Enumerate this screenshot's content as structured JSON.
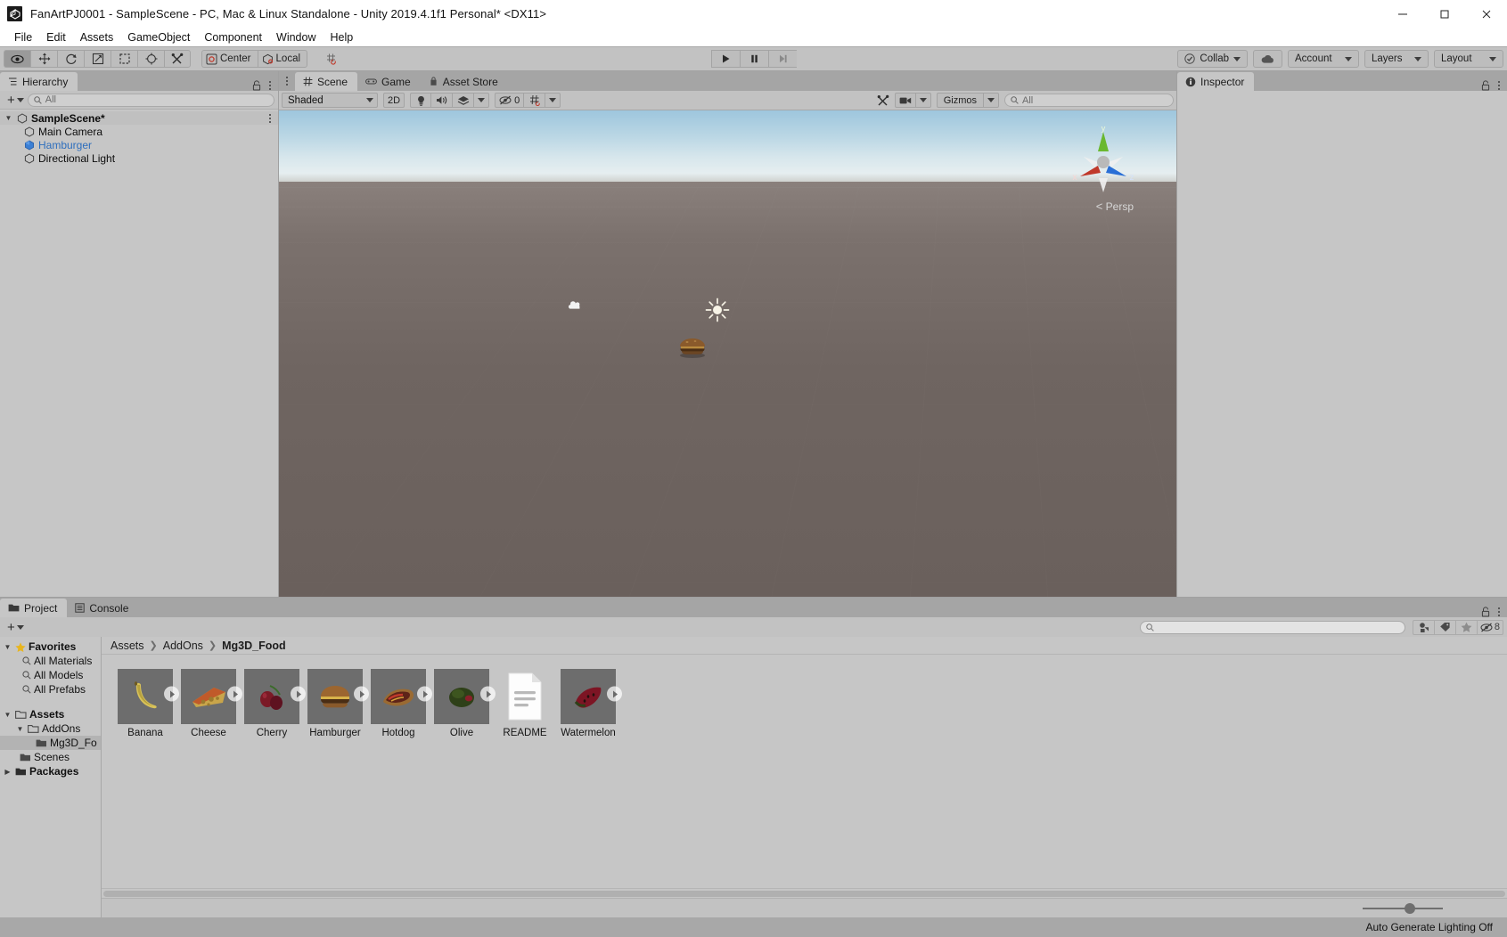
{
  "window": {
    "title": "FanArtPJ0001 - SampleScene - PC, Mac & Linux Standalone - Unity 2019.4.1f1 Personal* <DX11>",
    "minimize": "—",
    "maximize": "□",
    "close": "✕"
  },
  "menu": {
    "items": [
      "File",
      "Edit",
      "Assets",
      "GameObject",
      "Component",
      "Window",
      "Help"
    ]
  },
  "toolbar": {
    "tools": [
      {
        "name": "hand-tool-icon",
        "label": ""
      },
      {
        "name": "move-tool-icon",
        "label": ""
      },
      {
        "name": "rotate-tool-icon",
        "label": ""
      },
      {
        "name": "scale-tool-icon",
        "label": ""
      },
      {
        "name": "rect-tool-icon",
        "label": ""
      },
      {
        "name": "transform-tool-icon",
        "label": ""
      },
      {
        "name": "custom-tool-icon",
        "label": ""
      }
    ],
    "pivot": "Center",
    "space": "Local",
    "play": "▶",
    "pause": "❙❙",
    "step": "▶❙",
    "collab": "Collab",
    "cloud": "cloud-icon",
    "account": "Account",
    "layers": "Layers",
    "layout": "Layout"
  },
  "hierarchy": {
    "tab": "Hierarchy",
    "search_placeholder": "All",
    "create_label": "+",
    "tree": [
      {
        "label": "SampleScene*",
        "depth": 0,
        "expanded": true,
        "type": "scene",
        "selected": false
      },
      {
        "label": "Main Camera",
        "depth": 1,
        "expanded": false,
        "type": "object",
        "selected": false
      },
      {
        "label": "Hamburger",
        "depth": 1,
        "expanded": false,
        "type": "prefab",
        "selected": true
      },
      {
        "label": "Directional Light",
        "depth": 1,
        "expanded": false,
        "type": "object",
        "selected": false
      }
    ]
  },
  "scene": {
    "tabs": [
      {
        "label": "Scene",
        "icon": "grid-icon",
        "selected": true
      },
      {
        "label": "Game",
        "icon": "gamepad-icon",
        "selected": false
      },
      {
        "label": "Asset Store",
        "icon": "store-icon",
        "selected": false
      }
    ],
    "draw_mode": "Shaded",
    "mode_2d": "2D",
    "lighting_icon": "light-bulb-icon",
    "audio_icon": "audio-icon",
    "fx_icon": "fx-icon",
    "hidden_count": "0",
    "grid_icon": "grid-visibility-icon",
    "tools_icon": "scene-tools-icon",
    "camera_icon": "scene-camera-icon",
    "gizmos": "Gizmos",
    "search_placeholder": "All",
    "view_label": "Persp",
    "axis": {
      "x": "x",
      "y": "y",
      "z": "z"
    }
  },
  "inspector": {
    "tab": "Inspector"
  },
  "project": {
    "tabs": [
      {
        "label": "Project",
        "icon": "folder-icon",
        "selected": true
      },
      {
        "label": "Console",
        "icon": "console-icon",
        "selected": false
      }
    ],
    "create_label": "+",
    "search_placeholder": "",
    "filter_count": "8",
    "breadcrumb": [
      "Assets",
      "AddOns",
      "Mg3D_Food"
    ],
    "tree": [
      {
        "label": "Favorites",
        "depth": 0,
        "bold": true,
        "expanded": true,
        "icon": "star-icon",
        "selected": false
      },
      {
        "label": "All Materials",
        "depth": 1,
        "bold": false,
        "expanded": null,
        "icon": "search-icon",
        "selected": false
      },
      {
        "label": "All Models",
        "depth": 1,
        "bold": false,
        "expanded": null,
        "icon": "search-icon",
        "selected": false
      },
      {
        "label": "All Prefabs",
        "depth": 1,
        "bold": false,
        "expanded": null,
        "icon": "search-icon",
        "selected": false
      },
      {
        "label": "",
        "depth": 0,
        "bold": false,
        "expanded": null,
        "icon": "spacer",
        "selected": false
      },
      {
        "label": "Assets",
        "depth": 0,
        "bold": true,
        "expanded": true,
        "icon": "folder-open-icon",
        "selected": false
      },
      {
        "label": "AddOns",
        "depth": 1,
        "bold": false,
        "expanded": true,
        "icon": "folder-open-icon",
        "selected": false
      },
      {
        "label": "Mg3D_Fo",
        "depth": 2,
        "bold": false,
        "expanded": null,
        "icon": "folder-icon",
        "selected": true
      },
      {
        "label": "Scenes",
        "depth": 1,
        "bold": false,
        "expanded": null,
        "icon": "folder-icon",
        "selected": false
      },
      {
        "label": "Packages",
        "depth": 0,
        "bold": true,
        "expanded": false,
        "icon": "folder-icon",
        "selected": false
      }
    ],
    "assets": [
      {
        "label": "Banana",
        "kind": "model",
        "expandable": true
      },
      {
        "label": "Cheese",
        "kind": "model",
        "expandable": true
      },
      {
        "label": "Cherry",
        "kind": "model",
        "expandable": true
      },
      {
        "label": "Hamburger",
        "kind": "model",
        "expandable": true
      },
      {
        "label": "Hotdog",
        "kind": "model",
        "expandable": true
      },
      {
        "label": "Olive",
        "kind": "model",
        "expandable": true
      },
      {
        "label": "README",
        "kind": "text",
        "expandable": false
      },
      {
        "label": "Watermelon",
        "kind": "model",
        "expandable": true
      }
    ]
  },
  "status": {
    "text": "Auto Generate Lighting Off"
  },
  "colors": {
    "chrome": "#c2c2c2",
    "panel": "#c6c6c6",
    "tabstrip": "#a5a5a5",
    "accent_selected_text": "#2d6ebd",
    "axis_x": "#c0392b",
    "axis_y": "#6ab82f",
    "axis_z": "#2a6fd6",
    "statusbar": "#a8a8a8"
  }
}
